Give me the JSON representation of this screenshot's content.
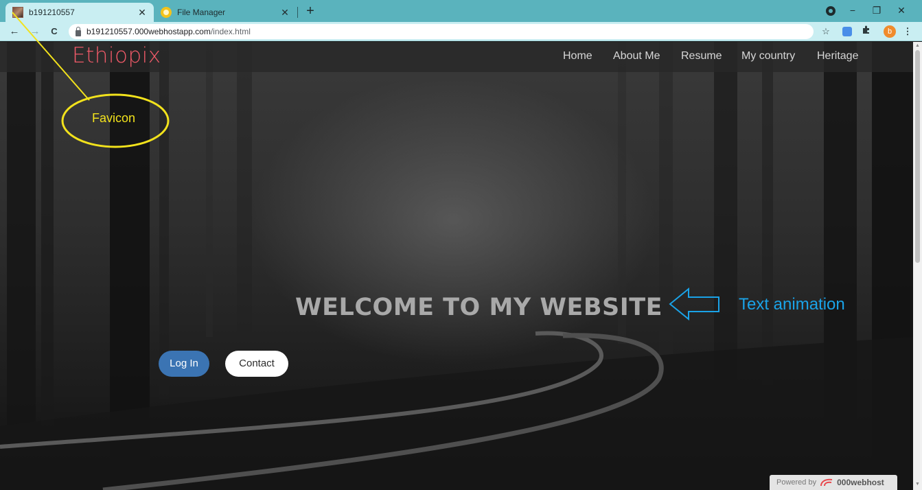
{
  "browser": {
    "tabs": [
      {
        "title": "b191210557",
        "favicon": "site-photo-favicon",
        "active": true
      },
      {
        "title": "File Manager",
        "favicon": "file-manager-favicon",
        "active": false
      }
    ],
    "new_tab_icon": "+",
    "window_controls": {
      "minimize": "−",
      "maximize": "❐",
      "close": "✕"
    },
    "url": {
      "domain": "b191210557.000webhostapp.com",
      "path": "/index.html"
    },
    "nav": {
      "back": "←",
      "forward": "→",
      "reload": "C"
    },
    "profile_initial": "b",
    "icons": {
      "bookmark": "☆",
      "extensions": "puzzle-icon",
      "menu": "⋮"
    }
  },
  "site": {
    "brand": "Ethiopix",
    "nav_items": [
      "Home",
      "About Me",
      "Resume",
      "My country",
      "Heritage"
    ],
    "hero_title": "WELCOME TO MY WEBSITE",
    "buttons": {
      "login": "Log In",
      "contact": "Contact"
    },
    "powered": {
      "prefix": "Powered by",
      "brand": "000webhost"
    }
  },
  "annotations": {
    "favicon_label": "Favicon",
    "text_animation_label": "Text animation",
    "favicon_color": "#f2e21c",
    "text_animation_color": "#1aa3e8"
  },
  "colors": {
    "tabbar": "#5ab3bd",
    "brand": "#ef5a68",
    "login_button": "#3b74b3"
  }
}
